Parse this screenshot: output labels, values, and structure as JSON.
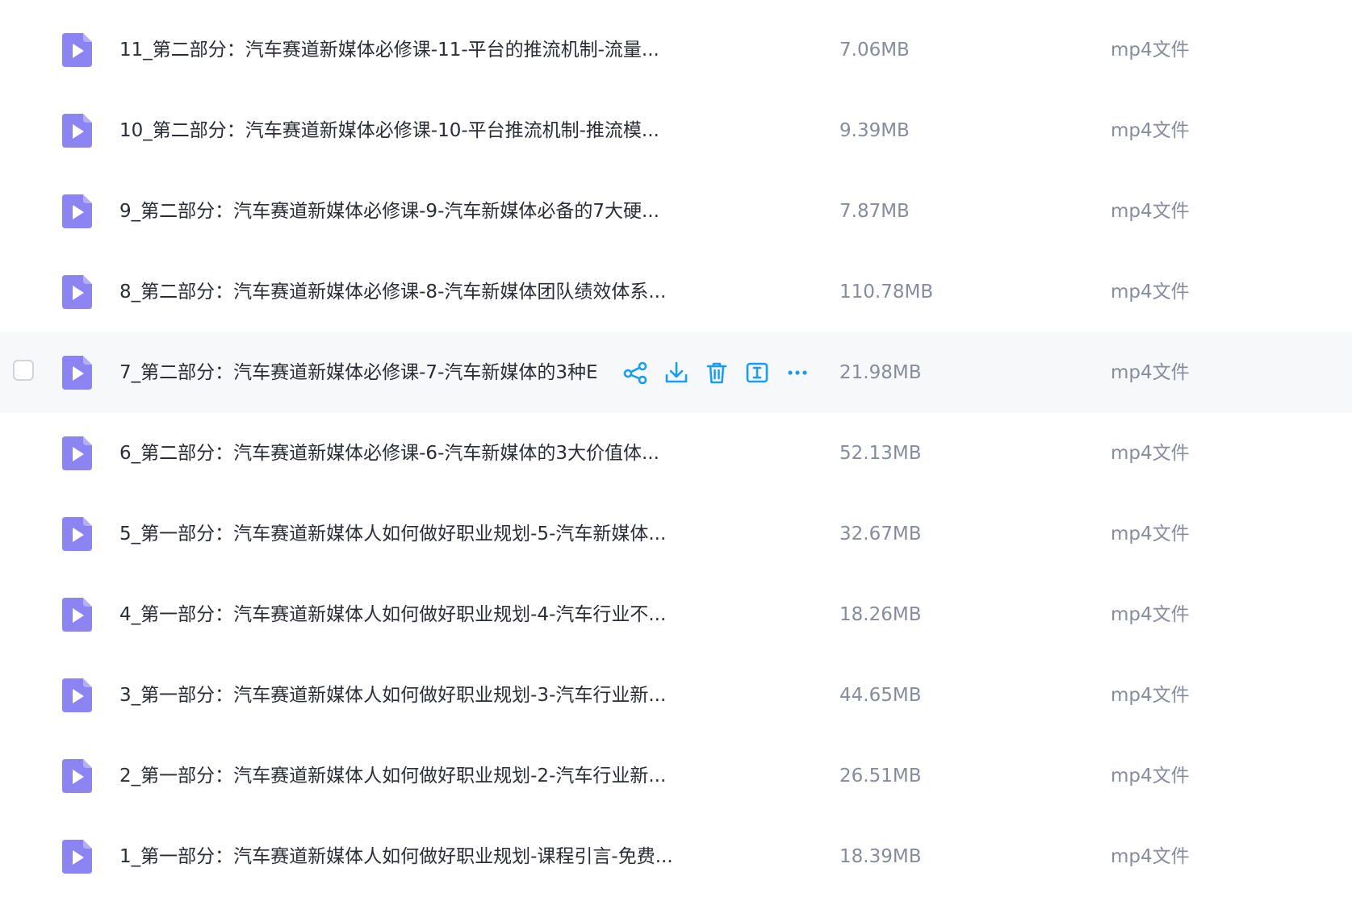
{
  "colors": {
    "file_icon": "#8d84f3",
    "action_icon": "#1b9cf5",
    "hover_row": "#f7f8fa",
    "name_text": "#2a2d36",
    "meta_text": "#878c9c"
  },
  "icons": {
    "file": "video-file-icon",
    "share": "share-icon",
    "download": "download-icon",
    "delete": "trash-icon",
    "rename": "rename-icon",
    "more": "more-icon"
  },
  "files": [
    {
      "name": "11_第二部分：汽车赛道新媒体必修课-11-平台的推流机制-流量...",
      "size": "7.06MB",
      "type": "mp4文件",
      "hovered": false
    },
    {
      "name": "10_第二部分：汽车赛道新媒体必修课-10-平台推流机制-推流模...",
      "size": "9.39MB",
      "type": "mp4文件",
      "hovered": false
    },
    {
      "name": "9_第二部分：汽车赛道新媒体必修课-9-汽车新媒体必备的7大硬...",
      "size": "7.87MB",
      "type": "mp4文件",
      "hovered": false
    },
    {
      "name": "8_第二部分：汽车赛道新媒体必修课-8-汽车新媒体团队绩效体系...",
      "size": "110.78MB",
      "type": "mp4文件",
      "hovered": false
    },
    {
      "name": "7_第二部分：汽车赛道新媒体必修课-7-汽车新媒体的3种E",
      "size": "21.98MB",
      "type": "mp4文件",
      "hovered": true
    },
    {
      "name": "6_第二部分：汽车赛道新媒体必修课-6-汽车新媒体的3大价值体...",
      "size": "52.13MB",
      "type": "mp4文件",
      "hovered": false
    },
    {
      "name": "5_第一部分：汽车赛道新媒体人如何做好职业规划-5-汽车新媒体...",
      "size": "32.67MB",
      "type": "mp4文件",
      "hovered": false
    },
    {
      "name": "4_第一部分：汽车赛道新媒体人如何做好职业规划-4-汽车行业不...",
      "size": "18.26MB",
      "type": "mp4文件",
      "hovered": false
    },
    {
      "name": "3_第一部分：汽车赛道新媒体人如何做好职业规划-3-汽车行业新...",
      "size": "44.65MB",
      "type": "mp4文件",
      "hovered": false
    },
    {
      "name": "2_第一部分：汽车赛道新媒体人如何做好职业规划-2-汽车行业新...",
      "size": "26.51MB",
      "type": "mp4文件",
      "hovered": false
    },
    {
      "name": "1_第一部分：汽车赛道新媒体人如何做好职业规划-课程引言-免费...",
      "size": "18.39MB",
      "type": "mp4文件",
      "hovered": false
    }
  ]
}
